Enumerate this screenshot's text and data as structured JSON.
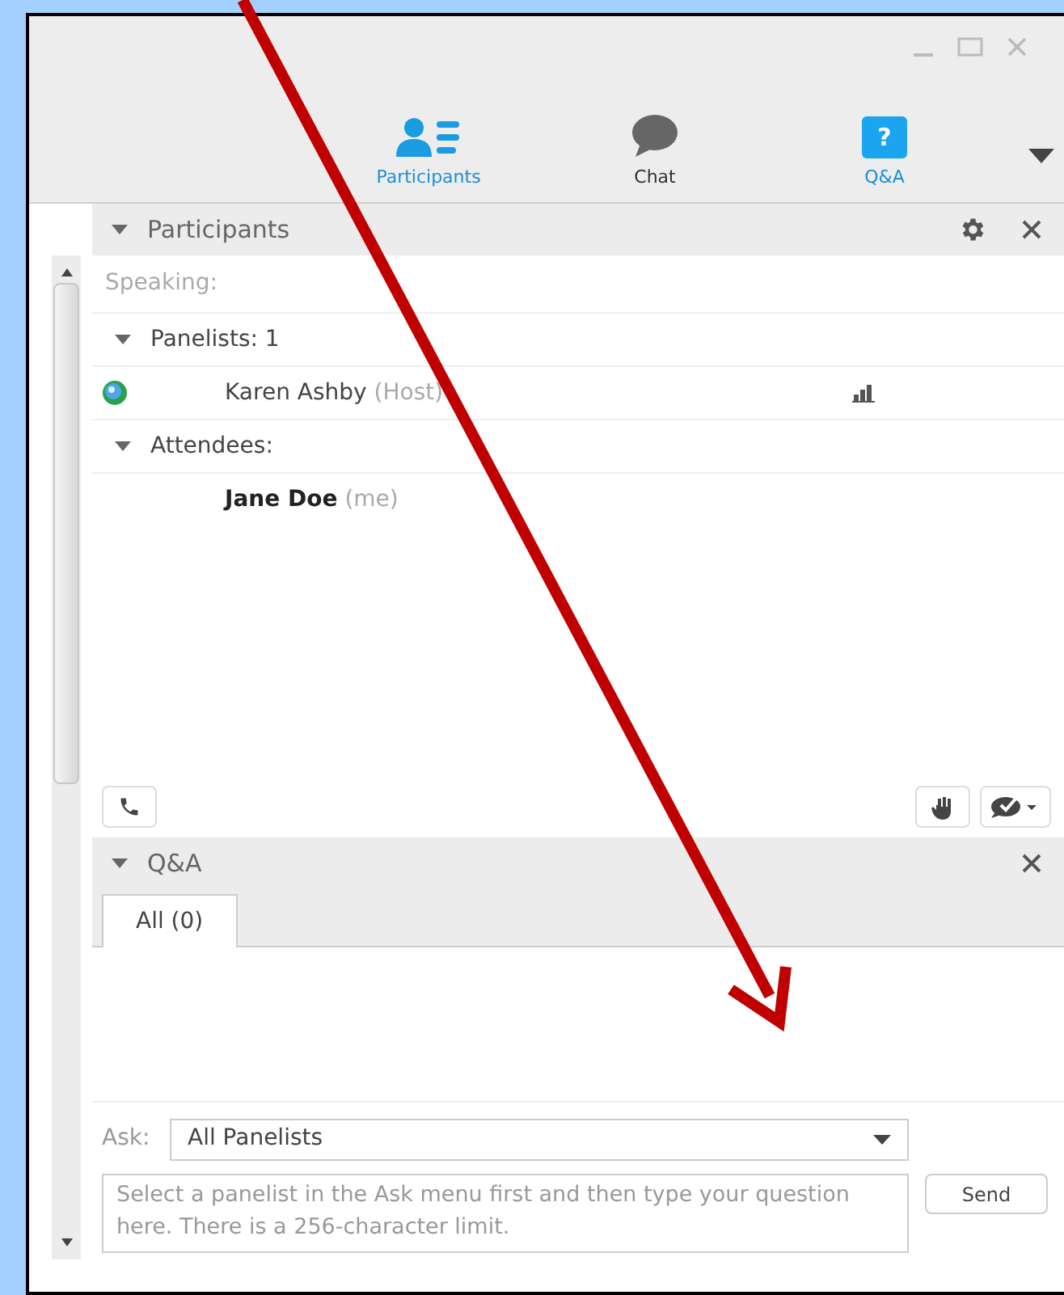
{
  "tabs": [
    {
      "label": "Participants",
      "selected": true
    },
    {
      "label": "Chat",
      "selected": false
    },
    {
      "label": "Q&A",
      "icon_text": "?",
      "selected": true
    }
  ],
  "participants_panel": {
    "title": "Participants",
    "speaking_label": "Speaking:",
    "groups": [
      {
        "label": "Panelists: 1",
        "expanded": true,
        "members": [
          {
            "name": "Karen Ashby",
            "role": "(Host)",
            "is_me": false,
            "has_status_icon": true,
            "has_signal_icon": true
          }
        ]
      },
      {
        "label": "Attendees:",
        "expanded": true,
        "members": [
          {
            "name": "Jane Doe",
            "role": "(me)",
            "is_me": true,
            "has_status_icon": false,
            "has_signal_icon": false
          }
        ]
      }
    ]
  },
  "qa_panel": {
    "title": "Q&A",
    "tabs": [
      {
        "label": "All (0)",
        "selected": true
      }
    ],
    "ask_label": "Ask:",
    "ask_value": "All Panelists",
    "question_placeholder": "Select a panelist in the Ask menu first and then type your question here. There is a 256-character limit.",
    "send_button": "Send"
  }
}
